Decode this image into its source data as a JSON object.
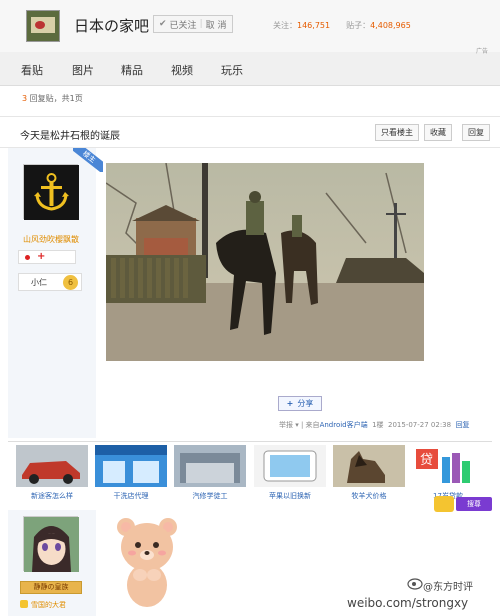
{
  "header": {
    "forum_title": "日本の家吧",
    "follow_label": "已关注",
    "cancel_label": "取 消",
    "followers_label": "关注：",
    "followers": "146,751",
    "posts_label": "贴子：",
    "posts": "4,408,965"
  },
  "nav": {
    "tabs": [
      "看贴",
      "图片",
      "精品",
      "视频",
      "玩乐"
    ]
  },
  "reply_info": {
    "count": "3",
    "text": " 回复贴，共1页"
  },
  "thread": {
    "title": "今天是松井石根的诞辰",
    "only_op_label": "只看楼主",
    "favorite_label": "收藏",
    "reply_label": "回复"
  },
  "post1": {
    "corner_tag": "楼主",
    "author": "山风劲吹樱飘散",
    "level_label": "小仁",
    "level": "6",
    "share_label": "分享",
    "report_label": "举报",
    "source_text": "| 来自",
    "client_link": "Android客户端",
    "floor": "1楼",
    "timestamp": "2015-07-27 02:38",
    "reply_label": "回复"
  },
  "ads": [
    {
      "caption": "新途客怎么样",
      "color": "#c0392b",
      "icon": "car-ad-image"
    },
    {
      "caption": "干洗店代理",
      "color": "#3a8fd9",
      "icon": "shop-ad-image"
    },
    {
      "caption": "汽修学徒工",
      "color": "#8a9aa8",
      "icon": "garage-ad-image"
    },
    {
      "caption": "苹果以旧换新",
      "color": "#f0f0f0",
      "icon": "phone-ad-image"
    },
    {
      "caption": "牧羊犬价格",
      "color": "#7a6a55",
      "icon": "dog-ad-image"
    },
    {
      "caption": "17岁贷款",
      "color": "#e74c3c",
      "icon": "loan-ad-image"
    }
  ],
  "ad_tag": "广告",
  "search_chip": "搜尊",
  "post2": {
    "badge": "静静の皇族",
    "author": "雪国的大君"
  },
  "watermark": {
    "line1": "@东方时评",
    "line2": "weibo.com/strongxy"
  },
  "colors": {
    "accent": "#e65c00",
    "link": "#2d64b3",
    "author": "#e08d00"
  }
}
